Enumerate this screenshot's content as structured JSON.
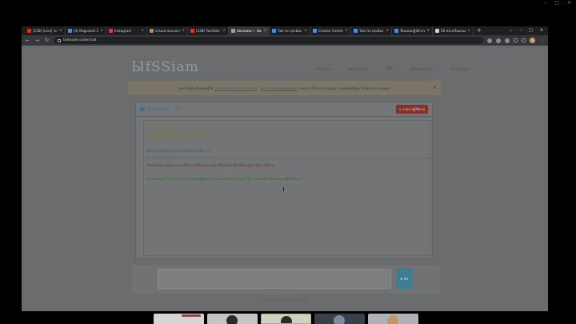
{
  "host_window": {
    "controls": [
      "–",
      "□",
      "✕"
    ]
  },
  "browser": {
    "tabs": [
      {
        "label": "(138) [Live] 'มามา",
        "color": "#e0321e"
      },
      {
        "label": "(4) Ragnarok 1 ...",
        "color": "#4d8be8"
      },
      {
        "label": "Instagram",
        "color": "#d5317a"
      },
      {
        "label": "ส่วนตลาดแนวทางหลาย",
        "color": "#b9884c"
      },
      {
        "label": "(138) YouTube",
        "color": "#e0321e"
      },
      {
        "label": "ห้องสนทนา - ห้องเดี่ยว",
        "color": "#9aa0a6",
        "active": true
      },
      {
        "label": "โพสารถ ทุกเมือง ภ.",
        "color": "#4d8be8"
      },
      {
        "label": "Creator Center",
        "color": "#4d8be8"
      },
      {
        "label": "โพสารถ ทุกเมือง ภ.",
        "color": "#4d8be8"
      },
      {
        "label": "ขั้นตอนปฏิบัติ ความเข",
        "color": "#4d8be8"
      },
      {
        "label": "50 หน่วยในแบบเอ",
        "color": "#cfcfcf"
      }
    ],
    "new_tab": "+",
    "window_controls": [
      "⌄",
      "–",
      "□",
      "✕"
    ],
    "url": "tidssiam.com/chat",
    "nav": {
      "back": "←",
      "forward": "→",
      "reload": "↻"
    }
  },
  "site": {
    "logo": "ЫfSSiam",
    "menu": [
      "หน้าแรก",
      "ห้องสนทนา",
      "FAQ",
      "สมัครสมาชิก",
      "เข้าสู่ระบบ"
    ],
    "notice": {
      "before": "ผลงานต้องเป็นของผู้ใช้",
      "link1": "โปรดอ่านนโยบายการใช้งาน",
      "link2": "นโยบายความเป็นส่วนตัว",
      "after": "ก่อนการใช้งาน โปรดแจ้ง โปรดแจ้งเตือน โปรดทราบ ขอบคุณ",
      "close": "×"
    },
    "chat": {
      "title": "ผู้ใช้ออนไลน์",
      "count": "12",
      "report_button": "⚠ รายงานผู้ใช้งาน",
      "messages": {
        "line1": "ยินดีต้อนรับเข้าสู่ห้องสนทนา",
        "line2": "โปรดปฏิบัติตามกฎและมารยาทในการสนทนา",
        "line3": "ห้องปัจจุบัน: \"Room Alert\"",
        "system": "คุณเข้าสู่ห้องแล้ว (03-10-2023 08:16 น.)",
        "warn": "ห้ามส่งข้อความหยาบคาย ข้อความที่ไม่เหมาะสม หรือสแปม มิฉะนั้นจะถูกระงับการใช้งาน",
        "info": "หากพบปัญหาในการใช้งาน โปรดแจ้งผู้ดูแลระบบ และท่านสามารถเข้าใช้งานได้ตามปกติ ขอบคุณที่ใช้บริการ"
      }
    },
    "composer": {
      "placeholder": "",
      "send": "➤ ส่ง"
    },
    "footer": "tidssiam © 2019 - 2023"
  }
}
